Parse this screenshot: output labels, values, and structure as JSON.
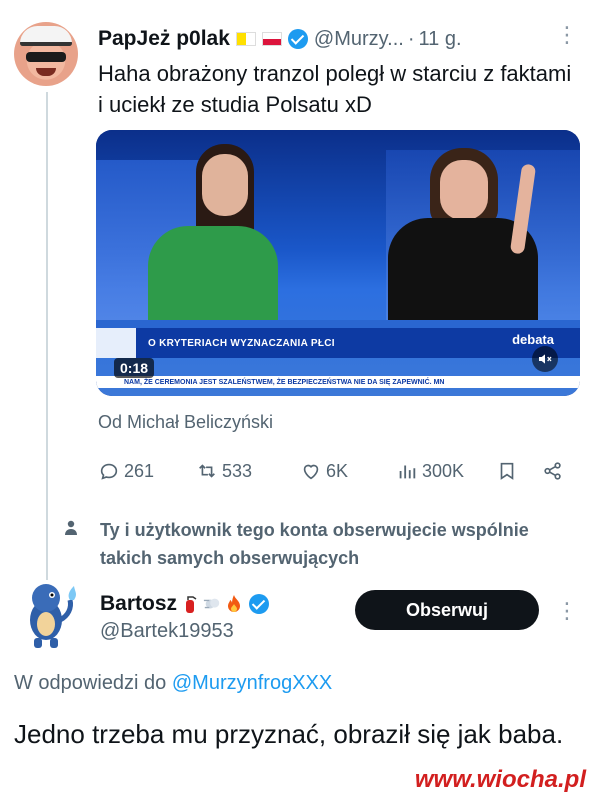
{
  "tweet": {
    "author_name": "PapJeż p0lak",
    "author_handle": "@Murzy...",
    "separator": "·",
    "time": "11 g.",
    "text": "Haha obrażony tranzol poległ w starciu z faktami i uciekł ze studia Polsatu xD",
    "video": {
      "duration": "0:18",
      "lower_third": "O KRYTERIACH WYZNACZANIA PŁCI",
      "show_logo": "debata",
      "ticker": "NAM, ŻE CEREMONIA JEST SZALEŃSTWEM, ŻE BEZPIECZEŃSTWA NIE DA SIĘ ZAPEWNIĆ. MN",
      "muted": true
    },
    "source_line": "Od Michał Beliczyński",
    "stats": {
      "replies": "261",
      "retweets": "533",
      "likes": "6K",
      "views": "300K"
    }
  },
  "follow_note": "Ty i użytkownik tego konta obserwujecie wspólnie takich samych obserwujących",
  "reply": {
    "author_name": "Bartosz",
    "author_handle": "@Bartek19953",
    "follow_label": "Obserwuj",
    "reply_prefix": "W odpowiedzi do",
    "reply_mention": "@MurzynfrogXXX",
    "text": "Jedno trzeba mu przyznać, obraził się jak baba."
  },
  "watermark": "www.wiocha.pl",
  "colors": {
    "accent": "#1d9bf0",
    "text": "#0f1419",
    "muted": "#536471",
    "watermark": "#d21f1f"
  },
  "icons": [
    "more-icon",
    "verified-icon",
    "reply-icon",
    "retweet-icon",
    "like-icon",
    "views-icon",
    "bookmark-icon",
    "share-icon",
    "person-icon",
    "mute-icon"
  ]
}
